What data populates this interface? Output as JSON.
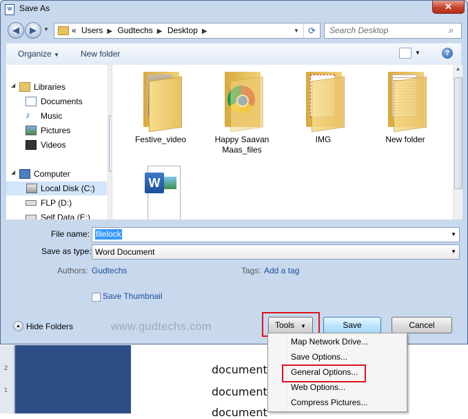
{
  "window": {
    "title": "Save As",
    "app_icon": "word-icon",
    "close_glyph": "✕"
  },
  "address": {
    "overflow": "«",
    "crumbs": [
      "Users",
      "Gudtechs",
      "Desktop"
    ],
    "search_placeholder": "Search Desktop"
  },
  "toolbar": {
    "organize_label": "Organize",
    "new_folder_label": "New folder",
    "help_glyph": "?"
  },
  "nav": {
    "items": [
      {
        "label": "Libraries",
        "icon": "libraries-icon"
      },
      {
        "label": "Documents",
        "icon": "documents-icon"
      },
      {
        "label": "Music",
        "icon": "music-icon"
      },
      {
        "label": "Pictures",
        "icon": "pictures-icon"
      },
      {
        "label": "Videos",
        "icon": "videos-icon"
      },
      {
        "label": "Computer",
        "icon": "computer-icon"
      },
      {
        "label": "Local Disk (C:)",
        "icon": "local-disk-icon",
        "selected": true
      },
      {
        "label": "FLP (D:)",
        "icon": "drive-icon"
      },
      {
        "label": "Self Data (E:)",
        "icon": "drive-icon"
      }
    ]
  },
  "files": [
    {
      "label": "Festive_video",
      "icon": "folder-icon"
    },
    {
      "label": "Happy Saavan Maas_files",
      "icon": "folder-icon"
    },
    {
      "label": "IMG",
      "icon": "folder-icon"
    },
    {
      "label": "New folder",
      "icon": "folder-icon"
    },
    {
      "label": "",
      "icon": "word-document-icon"
    }
  ],
  "form": {
    "file_name_label": "File name:",
    "file_name_value": "filelock",
    "save_type_label": "Save as type:",
    "save_type_value": "Word Document",
    "authors_label": "Authors:",
    "authors_value": "Gudtechs",
    "tags_label": "Tags:",
    "tags_value": "Add a tag",
    "thumbnail_label": "Save Thumbnail",
    "thumbnail_checked": false
  },
  "bottom": {
    "hide_folders_label": "Hide Folders",
    "watermark": "www.gudtechs.com",
    "tools_label": "Tools",
    "save_label": "Save",
    "cancel_label": "Cancel"
  },
  "tools_menu": {
    "items": [
      "Map Network Drive...",
      "Save Options...",
      "General Options...",
      "Web Options...",
      "Compress Pictures..."
    ],
    "highlighted": "General Options..."
  },
  "background_document": {
    "ruler_marks": [
      "2",
      "1"
    ],
    "lines": [
      "document द्वारा lock",
      "document करते है या जि",
      "document"
    ]
  },
  "colors": {
    "highlight_box": "#e0121c",
    "link": "#1b4e9b",
    "selection": "#3399ff"
  }
}
